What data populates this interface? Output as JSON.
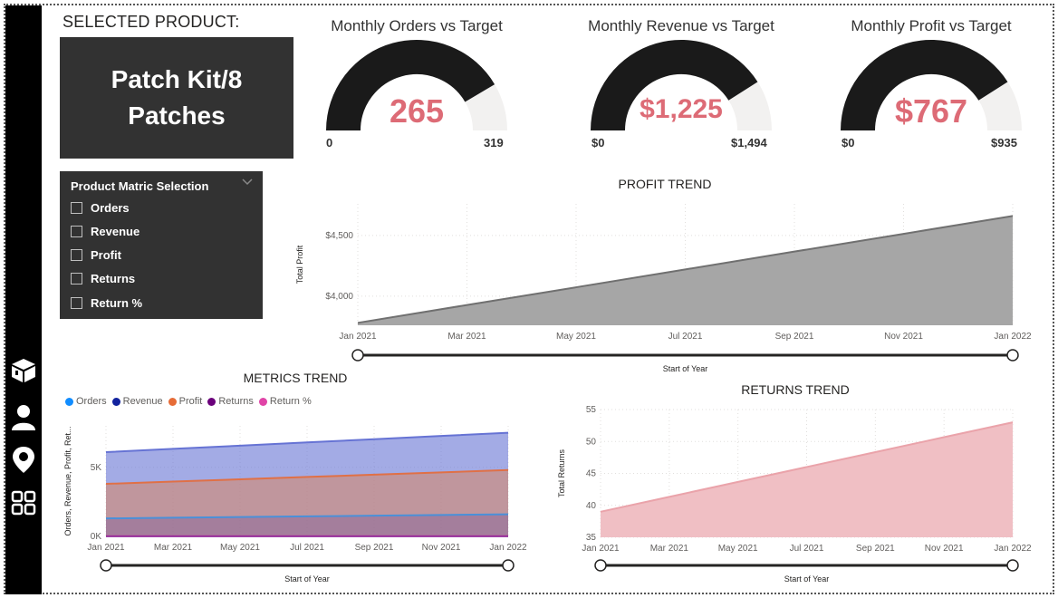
{
  "selected_product": {
    "label": "SELECTED PRODUCT:",
    "name": "Patch Kit/8 Patches"
  },
  "gauges": [
    {
      "title": "Monthly Orders vs Target",
      "value": "265",
      "min": "0",
      "max": "319",
      "fraction": 0.83
    },
    {
      "title": "Monthly Revenue vs Target",
      "value": "$1,225",
      "min": "$0",
      "max": "$1,494",
      "fraction": 0.82
    },
    {
      "title": "Monthly Profit vs Target",
      "value": "$767",
      "min": "$0",
      "max": "$935",
      "fraction": 0.82
    }
  ],
  "slicer": {
    "title": "Product Matric Selection",
    "items": [
      "Orders",
      "Revenue",
      "Profit",
      "Returns",
      "Return %"
    ]
  },
  "colors": {
    "gauge_fill": "#1a1a1a",
    "gauge_track": "#f2f1f0",
    "gauge_value": "#dd6b76",
    "profit_area": "#a6a6a6",
    "profit_line": "#707070",
    "returns_area": "#f0bfc4",
    "returns_line": "#eaa3aa",
    "orders": "#118dff",
    "revenue": "#12239e",
    "profit": "#e66c37",
    "returns": "#6b007b",
    "return_pct": "#e044a7"
  },
  "sidebar": {
    "icons": [
      "box-icon",
      "person-icon",
      "location-pin-icon",
      "dashboard-grid-icon"
    ]
  },
  "chart_data": [
    {
      "type": "area",
      "title": "PROFIT TREND",
      "xlabel": "Start of Year",
      "ylabel": "Total Profit",
      "x": [
        "Jan 2021",
        "Mar 2021",
        "May 2021",
        "Jul 2021",
        "Sep 2021",
        "Nov 2021",
        "Jan 2022"
      ],
      "ytick_labels": [
        "$4,000",
        "$4,500"
      ],
      "ylim": [
        3760,
        4760
      ],
      "series": [
        {
          "values": [
            3780,
            3927,
            4073,
            4220,
            4367,
            4513,
            4660
          ]
        }
      ],
      "grid": true
    },
    {
      "type": "area",
      "title": "METRICS TREND",
      "xlabel": "Start of Year",
      "ylabel": "Orders, Revenue, Profit, Ret...",
      "x": [
        "Jan 2021",
        "Mar 2021",
        "May 2021",
        "Jul 2021",
        "Sep 2021",
        "Nov 2021",
        "Jan 2022"
      ],
      "ytick_labels": [
        "0K",
        "5K"
      ],
      "ylim": [
        0,
        8000
      ],
      "legend": "top-left",
      "series": [
        {
          "name": "Orders",
          "values": [
            0,
            0,
            0,
            0,
            0,
            0,
            0
          ]
        },
        {
          "name": "Revenue",
          "values": [
            6100,
            6333,
            6567,
            6800,
            7033,
            7267,
            7500
          ]
        },
        {
          "name": "Profit",
          "values": [
            3800,
            3967,
            4133,
            4300,
            4467,
            4633,
            4800
          ]
        },
        {
          "name": "Returns",
          "values": [
            1300,
            1350,
            1400,
            1450,
            1500,
            1550,
            1600
          ]
        },
        {
          "name": "Return %",
          "values": [
            20,
            20,
            20,
            20,
            20,
            20,
            20
          ]
        }
      ],
      "grid": true
    },
    {
      "type": "area",
      "title": "RETURNS TREND",
      "xlabel": "Start of Year",
      "ylabel": "Total Returns",
      "x": [
        "Jan 2021",
        "Mar 2021",
        "May 2021",
        "Jul 2021",
        "Sep 2021",
        "Nov 2021",
        "Jan 2022"
      ],
      "yticks": [
        35,
        40,
        45,
        50,
        55
      ],
      "ytick_labels": [
        "35",
        "40",
        "45",
        "50",
        "55"
      ],
      "ylim": [
        35,
        55
      ],
      "series": [
        {
          "values": [
            39,
            41.33,
            43.67,
            46,
            48.33,
            50.67,
            53
          ]
        }
      ],
      "grid": true
    }
  ]
}
